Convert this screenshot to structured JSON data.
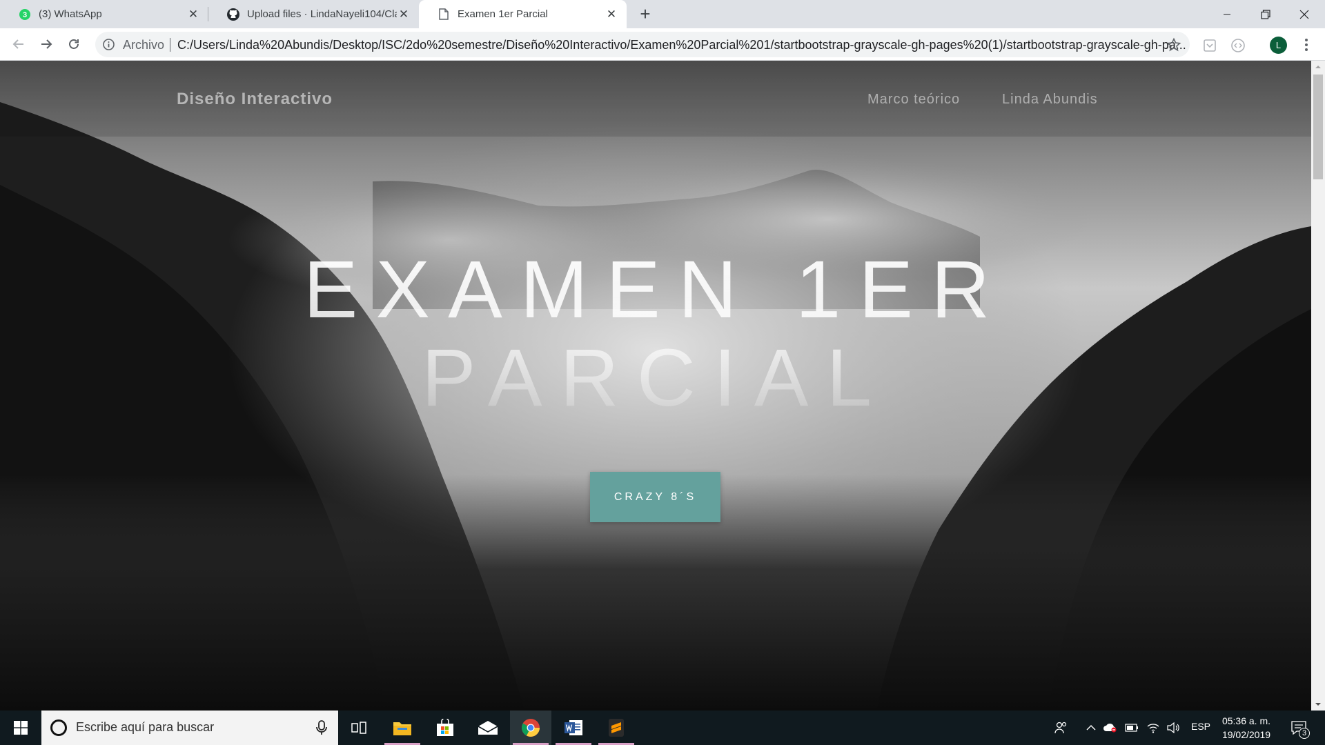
{
  "browser": {
    "tabs": [
      {
        "title": "(3) WhatsApp",
        "badge": "3",
        "icon": "whatsapp-icon"
      },
      {
        "title": "Upload files · LindaNayeli104/Cla",
        "icon": "github-icon"
      },
      {
        "title": "Examen 1er Parcial",
        "icon": "page-icon"
      }
    ],
    "address": {
      "scheme_label": "Archivo",
      "url": "C:/Users/Linda%20Abundis/Desktop/ISC/2do%20semestre/Diseño%20Interactivo/Examen%20Parcial%201/startbootstrap-grayscale-gh-pages%20(1)/startbootstrap-grayscale-gh-pa..."
    },
    "profile_initial": "L"
  },
  "page": {
    "brand": "Diseño Interactivo",
    "nav": [
      "Marco teórico",
      "Linda Abundis"
    ],
    "hero_line1": "Examen 1er",
    "hero_line2": "Parcial",
    "cta": "Crazy 8´s"
  },
  "taskbar": {
    "search_placeholder": "Escribe aquí para buscar",
    "language": "ESP",
    "time": "05:36 a. m.",
    "date": "19/02/2019",
    "notification_count": "3"
  },
  "colors": {
    "accent": "#64a19d",
    "tabbar": "#dee1e6",
    "taskbar": "#101a1f"
  }
}
